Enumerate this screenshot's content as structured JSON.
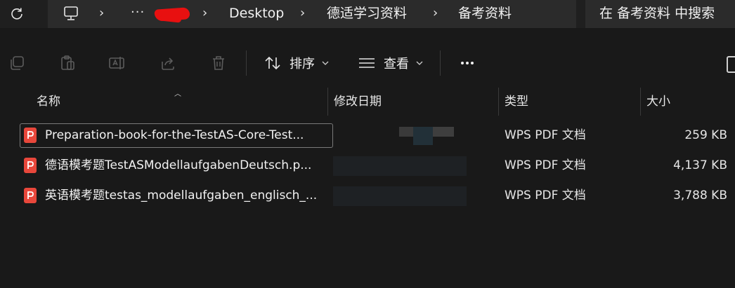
{
  "address_bar": {
    "crumbs": [
      "Desktop",
      "德适学习资料",
      "备考资料"
    ],
    "overflow": "···"
  },
  "search": {
    "placeholder": "在 备考资料 中搜索"
  },
  "toolbar": {
    "sort_label": "排序",
    "view_label": "查看"
  },
  "columns": {
    "name": "名称",
    "modified": "修改日期",
    "type": "类型",
    "size": "大小"
  },
  "files": [
    {
      "name": "Preparation-book-for-the-TestAS-Core-Test...",
      "type": "WPS PDF 文档",
      "size": "259 KB",
      "selected": true
    },
    {
      "name": "德语模考题TestASModellaufgabenDeutsch.p...",
      "type": "WPS PDF 文档",
      "size": "4,137 KB",
      "selected": false
    },
    {
      "name": "英语模考题testas_modellaufgaben_englisch_...",
      "type": "WPS PDF 文档",
      "size": "3,788 KB",
      "selected": false
    }
  ],
  "colors": {
    "background": "#191919",
    "pdf_icon": "#e8473b",
    "redaction": "#e81010"
  }
}
